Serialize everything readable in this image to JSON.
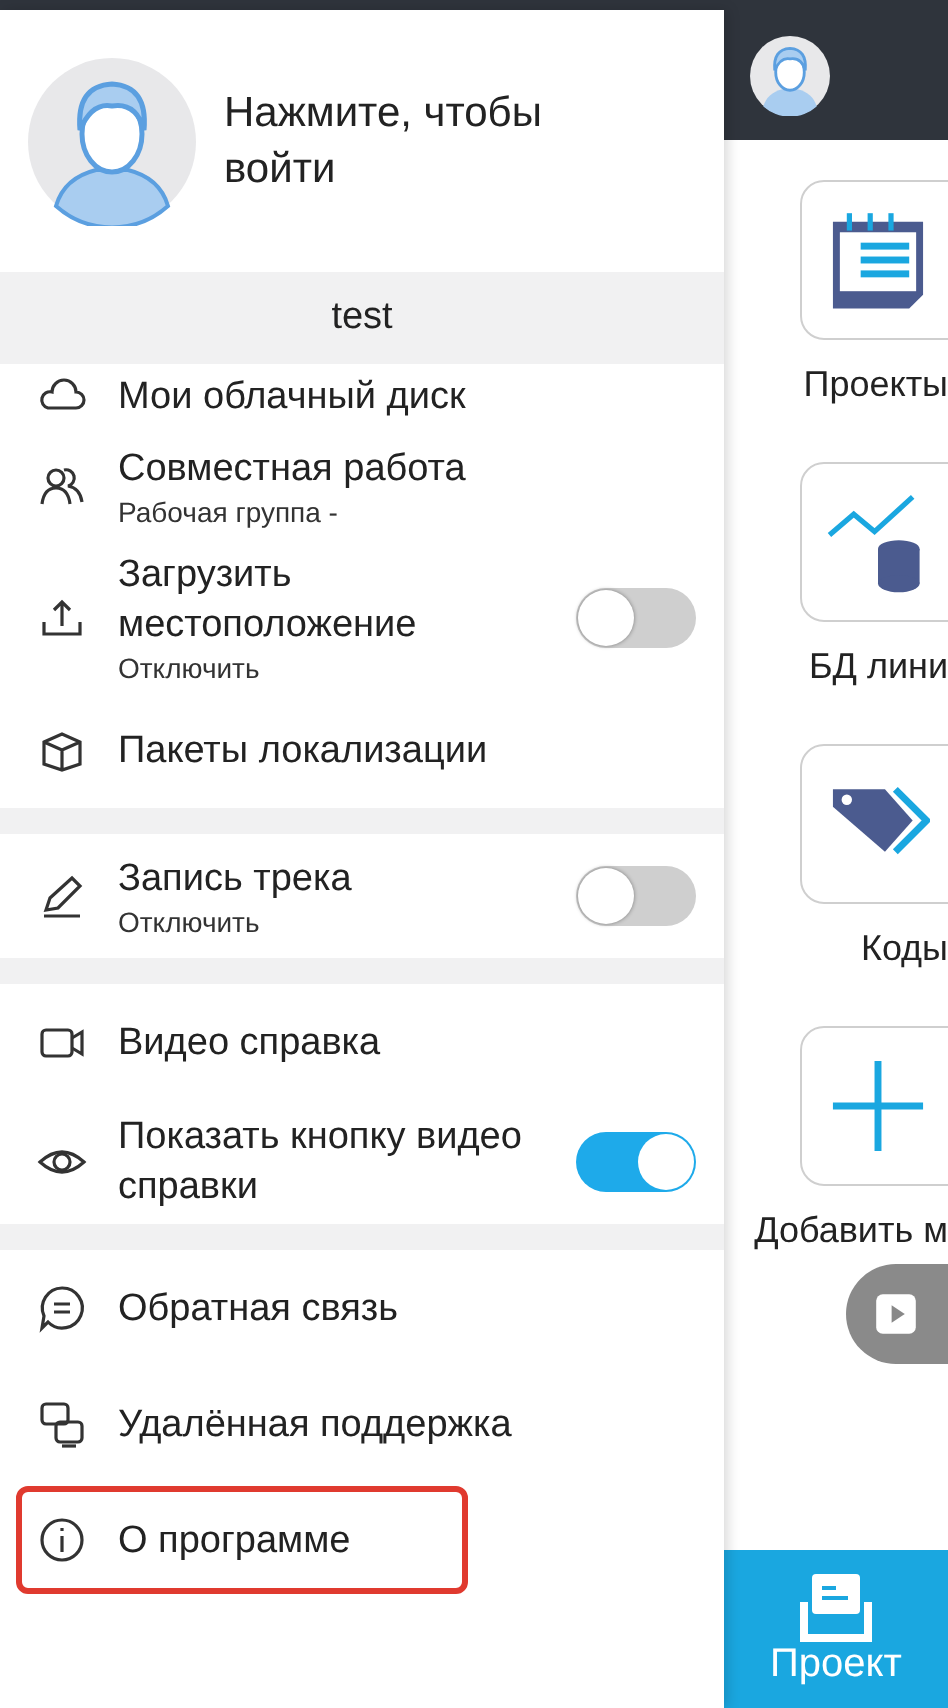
{
  "drawer": {
    "login_prompt": "Нажмите, чтобы войти",
    "workspace": "test",
    "menu_groups": [
      [
        {
          "kind": "item",
          "label": "Мои облачный диск"
        },
        {
          "kind": "item",
          "label": "Совместная работа",
          "subtitle": "Рабочая группа -"
        },
        {
          "kind": "toggle",
          "label": "Загрузить местоположение",
          "subtitle": "Отключить",
          "on": false
        },
        {
          "kind": "item",
          "label": "Пакеты локализации"
        }
      ],
      [
        {
          "kind": "toggle",
          "label": "Запись трека",
          "subtitle": "Отключить",
          "on": false
        }
      ],
      [
        {
          "kind": "item",
          "label": "Видео справка"
        },
        {
          "kind": "toggle",
          "label": "Показать кнопку видео справки",
          "on": true
        }
      ],
      [
        {
          "kind": "item",
          "label": "Обратная связь"
        },
        {
          "kind": "item",
          "label": "Удалённая поддержка"
        },
        {
          "kind": "item",
          "label": "О программе",
          "annotated": true
        }
      ]
    ]
  },
  "main": {
    "tiles": [
      {
        "label": "Проекты"
      },
      {
        "label": "БД лини"
      },
      {
        "label": "Коды"
      },
      {
        "label": "Добавить м"
      }
    ],
    "bottom_tab": {
      "label": "Проект",
      "selected": true
    }
  }
}
